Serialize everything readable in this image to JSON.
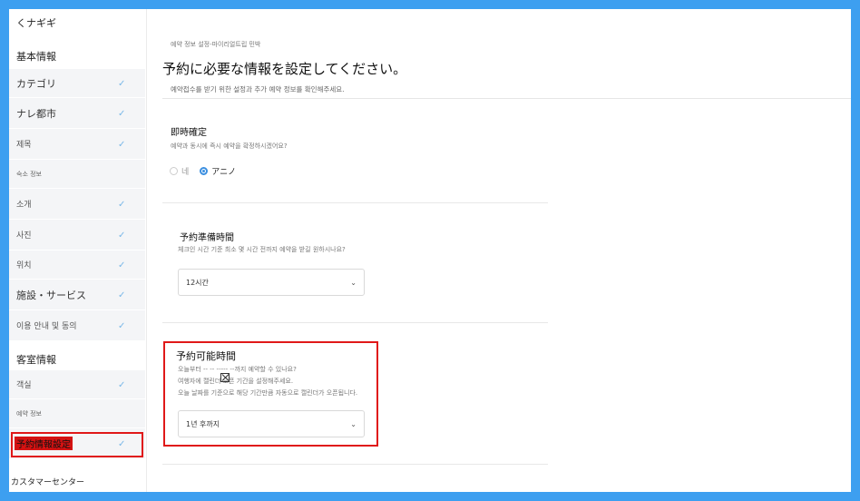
{
  "sidebar": {
    "back_label": "くナギギ",
    "basic_header": "基本情報",
    "items_basic": [
      {
        "label": "カテゴリ",
        "size": "big",
        "checked": true
      },
      {
        "label": "ナレ都市",
        "size": "big",
        "checked": true
      },
      {
        "label": "제목",
        "size": "small",
        "checked": true
      },
      {
        "label": "숙소 정보",
        "size": "tiny",
        "checked": false
      },
      {
        "label": "소개",
        "size": "small",
        "checked": true
      },
      {
        "label": "사진",
        "size": "small",
        "checked": true
      },
      {
        "label": "위치",
        "size": "small",
        "checked": true
      },
      {
        "label": "施設・サービス",
        "size": "big",
        "checked": true
      },
      {
        "label": "이용 안내 및 동의",
        "size": "small",
        "checked": true
      }
    ],
    "room_header": "客室情報",
    "items_room": [
      {
        "label": "객실",
        "size": "small",
        "checked": true
      },
      {
        "label": "예약 정보",
        "size": "tiny",
        "checked": false
      },
      {
        "label": "予約情報設定",
        "size": "big",
        "checked": true
      }
    ],
    "customer_center": "カスタマーセンター",
    "check_glyph": "✓"
  },
  "main": {
    "breadcrumb": "예약 정보 설정-마이리얼트립 민박",
    "title": "予約に必要な情報を設定してください。",
    "subtitle": "예약접수를 받기 위한 설정과 추가 예약 정보를 확인해주세요.",
    "instant": {
      "title": "即時確定",
      "desc": "예약과 동시에 즉시 예약을 확정하시겠어요?",
      "options": [
        {
          "label": "네",
          "selected": false
        },
        {
          "label": "アニノ",
          "selected": true
        }
      ]
    },
    "prep": {
      "title": "予約準備時間",
      "desc": "체크인 시간 기준 최소 몇 시간 전까지 예약을 받길 원하시나요?",
      "value": "12시간"
    },
    "available": {
      "title": "予約可能時間",
      "desc_lines": [
        "오늘부터 -- -- ----- --까지 예약할 수 있나요?",
        "여행자에          캘린더 오픈 기간을 설정해주세요.",
        "오늘 날짜를 기준으로 해당 기간만큼 자동으로 캘린더가 오픈됩니다."
      ],
      "value": "1년 후까지"
    },
    "chevron_glyph": "⌄"
  },
  "colors": {
    "frame_bg": "#3d9ff0",
    "highlight": "#e01818",
    "check": "#7ab8e8",
    "radio_on": "#3b8fe0"
  }
}
